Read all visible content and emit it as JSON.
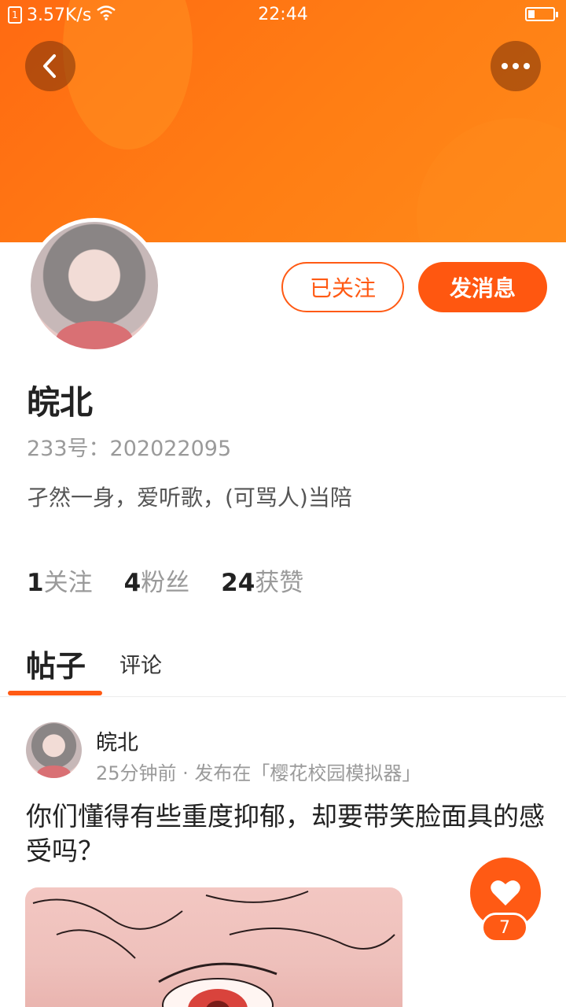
{
  "status_bar": {
    "speed": "3.57K/s",
    "time": "22:44"
  },
  "header": {
    "back_icon": "chevron-left-icon",
    "more_icon": "more-horizontal-icon"
  },
  "profile": {
    "follow_button_label": "已关注",
    "message_button_label": "发消息",
    "name": "皖北",
    "id_line": "233号：202022095",
    "bio": "孑然一身，爱听歌，(可骂人)当陪",
    "stats": [
      {
        "num": "1",
        "label": "关注"
      },
      {
        "num": "4",
        "label": "粉丝"
      },
      {
        "num": "24",
        "label": "获赞"
      }
    ]
  },
  "tabs": [
    {
      "label": "帖子"
    },
    {
      "label": "评论"
    }
  ],
  "post": {
    "author": "皖北",
    "meta": "25分钟前 · 发布在「樱花校园模拟器」",
    "text": "你们懂得有些重度抑郁，却要带笑脸面具的感受吗？"
  },
  "like": {
    "count": "7"
  },
  "colors": {
    "accent": "#ff5a14",
    "banner": "#ff7a14"
  }
}
